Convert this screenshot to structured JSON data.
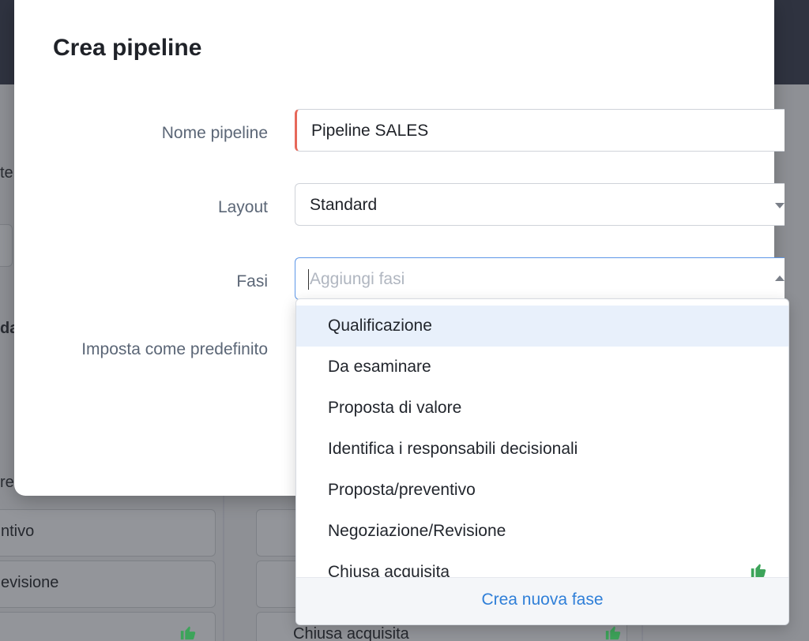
{
  "background": {
    "fragments": [
      "te",
      "da",
      "re",
      "ntivo",
      "evisione"
    ],
    "cards": [
      "Chiusa acquisita"
    ],
    "colors": {
      "header": "#2f3340",
      "overlay": "#8e9095",
      "thumb": "#3da45a"
    }
  },
  "modal": {
    "title": "Crea pipeline",
    "fields": {
      "name": {
        "label": "Nome pipeline",
        "value": "Pipeline SALES"
      },
      "layout": {
        "label": "Layout",
        "value": "Standard"
      },
      "stages": {
        "label": "Fasi",
        "placeholder": "Aggiungi fasi"
      },
      "default": {
        "label": "Imposta come predefinito"
      }
    }
  },
  "dropdown": {
    "options": [
      "Qualificazione",
      "Da esaminare",
      "Proposta di valore",
      "Identifica i responsabili decisionali",
      "Proposta/preventivo",
      "Negoziazione/Revisione",
      "Chiusa acquisita"
    ],
    "highlighted": "Qualificazione",
    "footer_link": "Crea nuova fase",
    "colors": {
      "highlight": "#e8f0fb",
      "link": "#2f7fd8",
      "thumb": "#3da45a"
    }
  }
}
